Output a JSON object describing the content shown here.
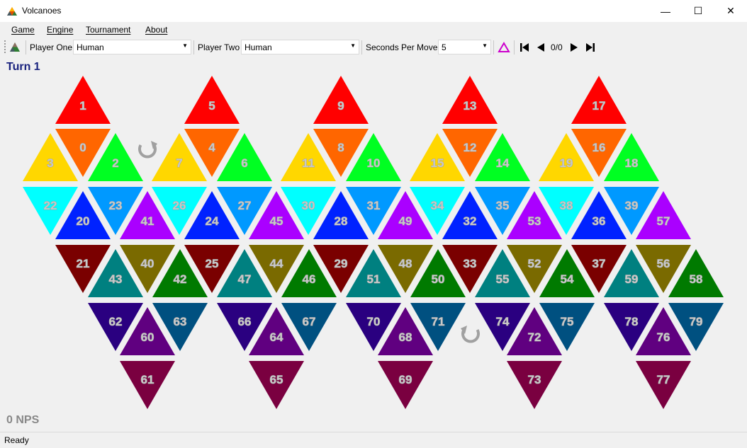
{
  "window": {
    "title": "Volcanoes",
    "minimize": "—",
    "maximize": "☐",
    "close": "✕"
  },
  "menu": {
    "items": [
      "Game",
      "Engine",
      "Tournament",
      "About"
    ]
  },
  "toolbar": {
    "player_one_label": "Player One",
    "player_one_value": "Human",
    "player_two_label": "Player Two",
    "player_two_value": "Human",
    "seconds_label": "Seconds Per Move",
    "seconds_value": "5",
    "move_counter": "0/0"
  },
  "status": {
    "turn": "Turn 1",
    "nps": "0 NPS",
    "statusbar": "Ready"
  },
  "colors": {
    "red": "#ff0000",
    "orange": "#ff6600",
    "yellow": "#ffd700",
    "green": "#00ff22",
    "cyan": "#00ffff",
    "skyblue": "#0099ff",
    "blue": "#0022ff",
    "purple": "#aa00ff",
    "maroon": "#7a0000",
    "teal": "#008080",
    "olive": "#7a6a00",
    "darkgreen": "#007a00",
    "indigo": "#2a0080",
    "violet": "#600080",
    "navyteal": "#005080",
    "wine": "#7a0040",
    "rotate_icon": "#a0a0a0",
    "accent_triangle": "#cc00cc"
  },
  "board": {
    "groups": [
      {
        "ids": [
          1,
          0,
          3,
          2,
          22,
          20,
          23,
          21,
          43,
          40,
          62,
          60,
          63,
          61
        ],
        "extra_right": 41
      },
      {
        "ids": [
          5,
          4,
          7,
          6,
          26,
          24,
          27,
          25,
          47,
          44,
          66,
          64,
          67,
          65
        ],
        "extra_right": 45
      },
      {
        "ids": [
          9,
          8,
          11,
          10,
          30,
          28,
          31,
          29,
          51,
          48,
          70,
          68,
          71,
          69
        ],
        "extra_right": 49
      },
      {
        "ids": [
          13,
          12,
          15,
          14,
          34,
          32,
          35,
          33,
          55,
          52,
          74,
          72,
          75,
          73
        ],
        "extra_right": 53
      },
      {
        "ids": [
          17,
          16,
          19,
          18,
          38,
          36,
          39,
          37,
          59,
          56,
          78,
          76,
          79,
          77
        ],
        "extra_right": 57
      }
    ],
    "between": [
      42,
      46,
      50,
      54,
      58
    ],
    "rotate_icons": [
      "rotate-icon",
      "rotate-icon"
    ]
  }
}
